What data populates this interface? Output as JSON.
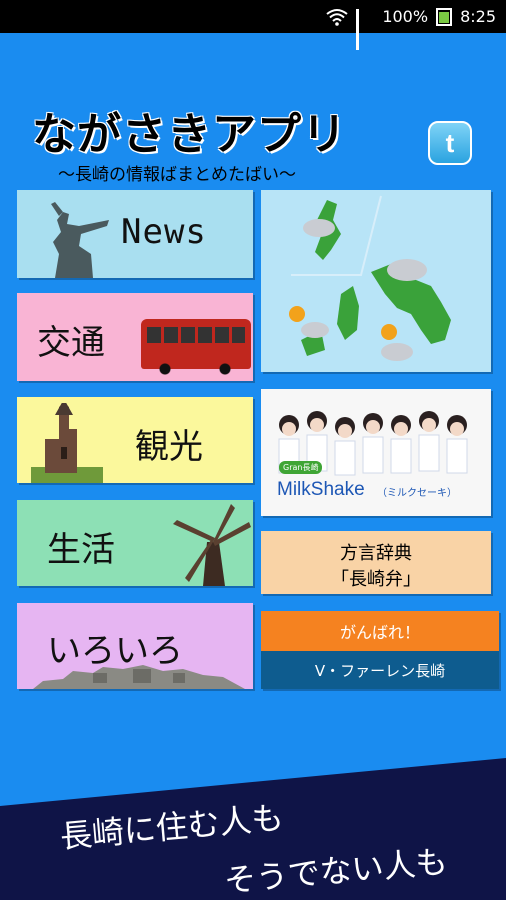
{
  "status_bar": {
    "battery": "100%",
    "time": "8:25",
    "icons": [
      "wifi-icon",
      "signal-icon",
      "battery-charging-icon"
    ]
  },
  "header": {
    "title": "ながさきアプリ",
    "subtitle": "〜長崎の情報ばまとめたばい〜",
    "twitter_label": "t",
    "twitter_icon": "twitter-icon"
  },
  "menu": {
    "news": "News",
    "kotsu": "交通",
    "kanko": "観光",
    "seikatsu": "生活",
    "iroiro": "いろいろ"
  },
  "milkshake": {
    "logo": "MilkShake",
    "reading": "（ミルクセーキ）",
    "badge": "Gran長崎"
  },
  "hogen": {
    "line1": "方言辞典",
    "line2": "「長崎弁」"
  },
  "v_varen": {
    "cheer": "がんばれ！",
    "team": "V・ファーレン長崎"
  },
  "banner": {
    "line1": "長崎に住む人も",
    "line2": "そうでない人も"
  },
  "colors": {
    "background": "#1a8cf0",
    "banner": "#0f1447",
    "news": "#a9dff0",
    "kotsu": "#f9b4d4",
    "kanko": "#fbf89c",
    "seikatsu": "#8de0b5",
    "iroiro": "#e6b5f2",
    "hogen": "#f9d3a6",
    "vv_top": "#f58220",
    "vv_bottom": "#0e5c8f"
  }
}
